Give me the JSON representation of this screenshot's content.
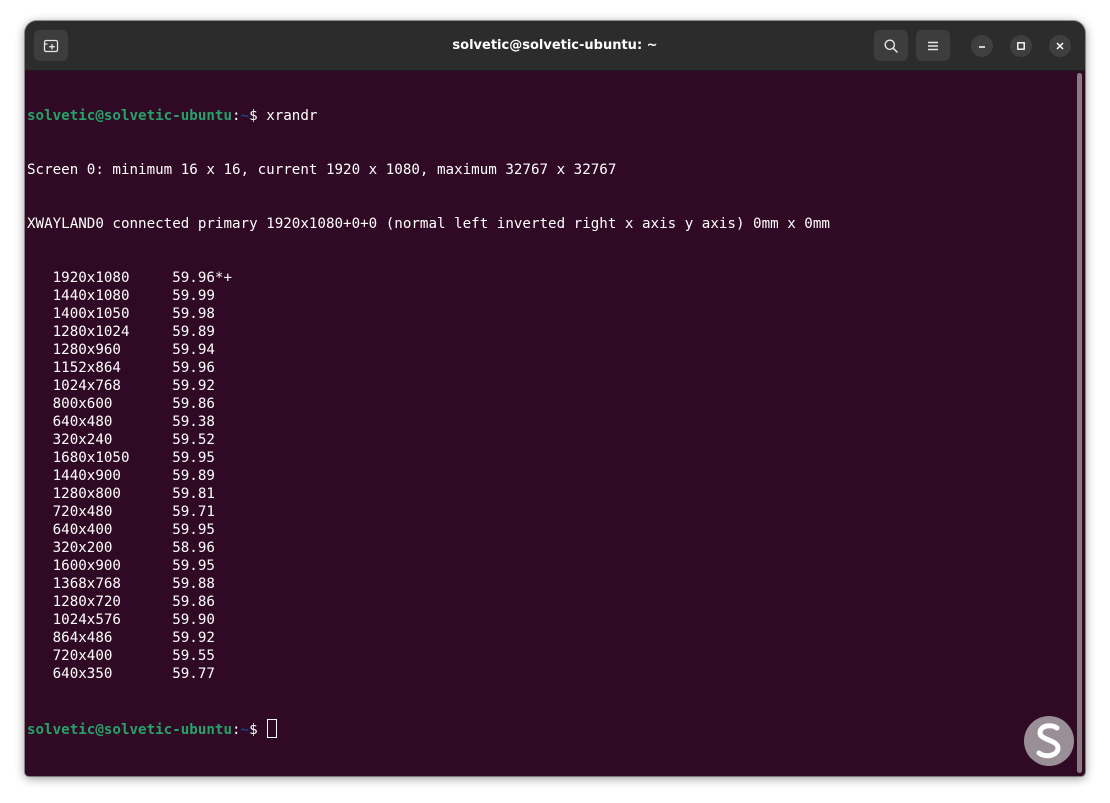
{
  "window": {
    "title": "solvetic@solvetic-ubuntu: ~",
    "new_tab_icon": "new-tab-icon",
    "search_icon": "search-icon",
    "menu_icon": "hamburger-menu-icon",
    "minimize_icon": "minimize-icon",
    "maximize_icon": "maximize-icon",
    "close_icon": "close-icon"
  },
  "colors": {
    "terminal_bg": "#300a24",
    "prompt_user": "#26a269",
    "prompt_path": "#12488b",
    "text": "#ffffff"
  },
  "terminal": {
    "prompt": {
      "user_host": "solvetic@solvetic-ubuntu",
      "colon": ":",
      "path": "~",
      "symbol": "$ "
    },
    "command": "xrandr",
    "screen_line": "Screen 0: minimum 16 x 16, current 1920 x 1080, maximum 32767 x 32767",
    "output_line": "XWAYLAND0 connected primary 1920x1080+0+0 (normal left inverted right x axis y axis) 0mm x 0mm",
    "modes": [
      {
        "resolution": "1920x1080",
        "rate": "59.96*+"
      },
      {
        "resolution": "1440x1080",
        "rate": "59.99"
      },
      {
        "resolution": "1400x1050",
        "rate": "59.98"
      },
      {
        "resolution": "1280x1024",
        "rate": "59.89"
      },
      {
        "resolution": "1280x960",
        "rate": "59.94"
      },
      {
        "resolution": "1152x864",
        "rate": "59.96"
      },
      {
        "resolution": "1024x768",
        "rate": "59.92"
      },
      {
        "resolution": "800x600",
        "rate": "59.86"
      },
      {
        "resolution": "640x480",
        "rate": "59.38"
      },
      {
        "resolution": "320x240",
        "rate": "59.52"
      },
      {
        "resolution": "1680x1050",
        "rate": "59.95"
      },
      {
        "resolution": "1440x900",
        "rate": "59.89"
      },
      {
        "resolution": "1280x800",
        "rate": "59.81"
      },
      {
        "resolution": "720x480",
        "rate": "59.71"
      },
      {
        "resolution": "640x400",
        "rate": "59.95"
      },
      {
        "resolution": "320x200",
        "rate": "58.96"
      },
      {
        "resolution": "1600x900",
        "rate": "59.95"
      },
      {
        "resolution": "1368x768",
        "rate": "59.88"
      },
      {
        "resolution": "1280x720",
        "rate": "59.86"
      },
      {
        "resolution": "1024x576",
        "rate": "59.90"
      },
      {
        "resolution": "864x486",
        "rate": "59.92"
      },
      {
        "resolution": "720x400",
        "rate": "59.55"
      },
      {
        "resolution": "640x350",
        "rate": "59.77"
      }
    ]
  },
  "watermark": {
    "icon": "solvetic-logo-icon"
  }
}
